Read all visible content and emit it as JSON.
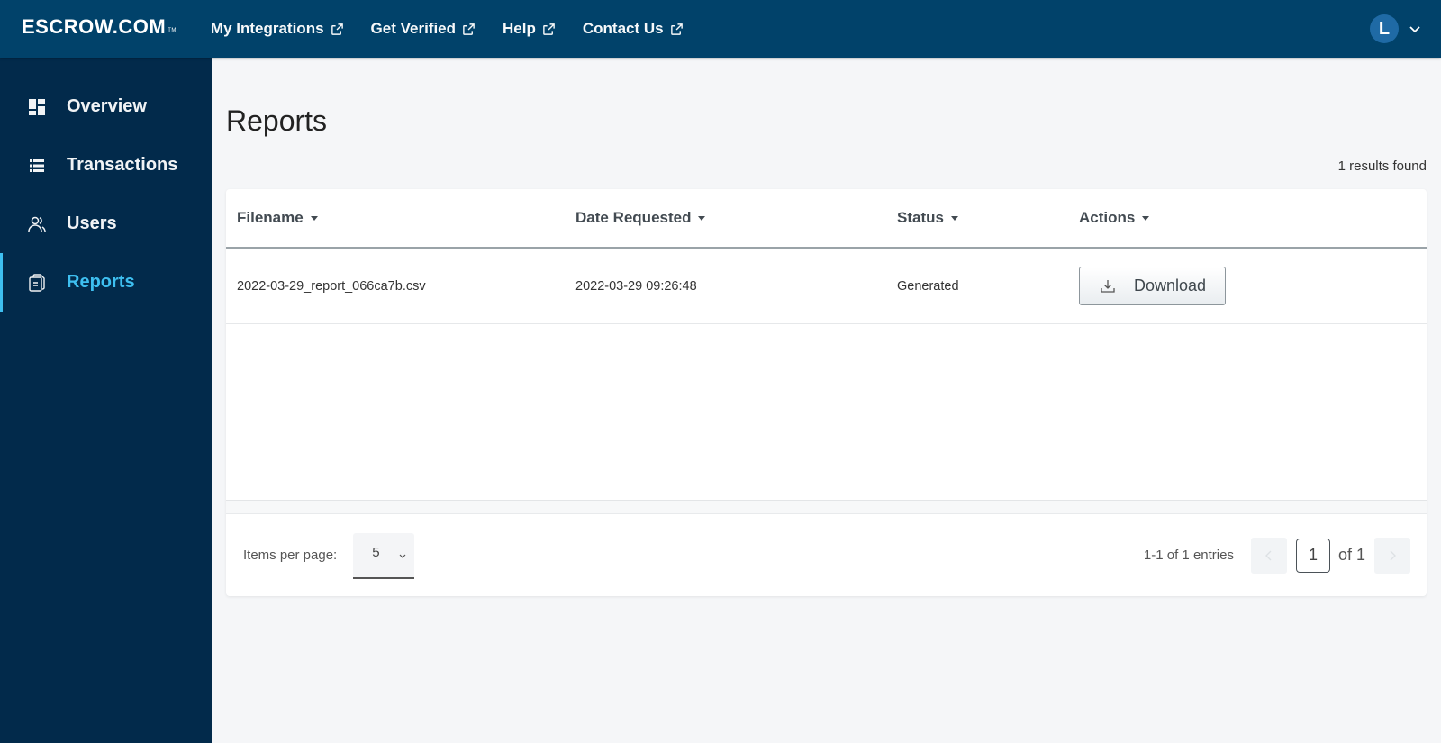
{
  "header": {
    "logo": "ESCROW.COM",
    "logo_tm": "TM",
    "nav": [
      {
        "label": "My Integrations",
        "icon": "external-link-icon"
      },
      {
        "label": "Get Verified",
        "icon": "external-link-icon"
      },
      {
        "label": "Help",
        "icon": "external-link-icon"
      },
      {
        "label": "Contact Us",
        "icon": "external-link-icon"
      }
    ],
    "user_initial": "L",
    "user_menu_icon": "chevron-down-icon"
  },
  "sidebar": {
    "items": [
      {
        "label": "Overview",
        "icon": "dashboard-icon",
        "active": false
      },
      {
        "label": "Transactions",
        "icon": "list-icon",
        "active": false
      },
      {
        "label": "Users",
        "icon": "users-icon",
        "active": false
      },
      {
        "label": "Reports",
        "icon": "reports-icon",
        "active": true
      }
    ]
  },
  "main": {
    "title": "Reports",
    "results_found": "1 results found",
    "table": {
      "columns": [
        "Filename",
        "Date Requested",
        "Status",
        "Actions"
      ],
      "rows": [
        {
          "filename": "2022-03-29_report_066ca7b.csv",
          "date_requested": "2022-03-29 09:26:48",
          "status": "Generated",
          "action_label": "Download"
        }
      ]
    },
    "pagination": {
      "items_per_page_label": "Items per page:",
      "items_per_page": "5",
      "entries": "1-1 of 1 entries",
      "current_page": "1",
      "of_total": "of 1"
    }
  },
  "colors": {
    "topbar": "#01426a",
    "sidebar": "#022a4b",
    "active_accent": "#3ebff0",
    "background": "#f5f6f8"
  }
}
